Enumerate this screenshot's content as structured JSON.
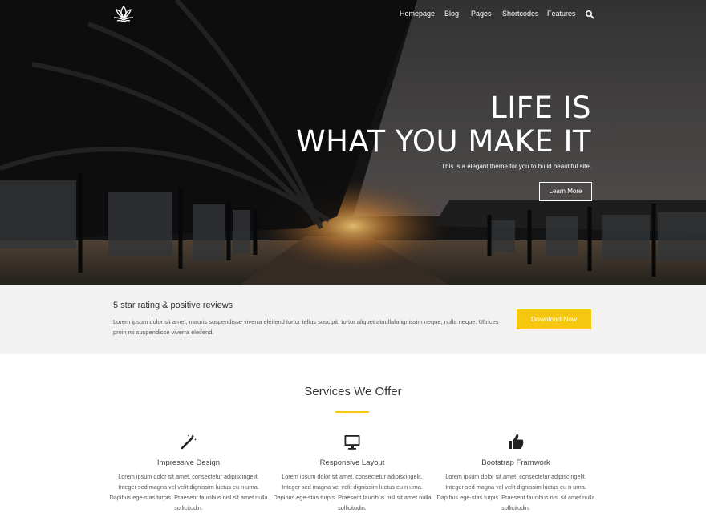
{
  "nav": {
    "items": [
      "Homepage",
      "Blog",
      "Pages",
      "Shortcodes",
      "Features"
    ]
  },
  "hero": {
    "title_line1": "LIFE IS",
    "title_line2": "WHAT YOU MAKE IT",
    "subtitle": "This is a elegant theme for you to build beautiful site.",
    "button_label": "Learn More"
  },
  "cta": {
    "heading": "5 star rating & positive reviews",
    "text": "Lorem ipsum dolor sit amet, mauris suspendisse viverra eleifend tortor tellus suscipit, tortor aliquet atnullafa ignissim neque, nulla neque. Ultrices proin mi suspendisse viverra eleifend.",
    "button_label": "Download Now"
  },
  "services": {
    "title": "Services We Offer",
    "items": [
      {
        "icon": "magic-wand-icon",
        "title": "Impressive Design",
        "text": "Lorem ipsum dolor sit amet, consectetur adipiscingelit. Integer sed magna vel velit dignissim luctus eu n urna. Dapibus ege-stas turpis. Praesent faucibus nisl sit amet nulla sollicitudin."
      },
      {
        "icon": "monitor-icon",
        "title": "Responsive Layout",
        "text": "Lorem ipsum dolor sit amet, consectetur adipiscingelit. Integer sed magna vel velit dignissim luctus eu n urna. Dapibus ege-stas turpis. Praesent faucibus nisl sit amet nulla sollicitudin."
      },
      {
        "icon": "thumbs-up-icon",
        "title": "Bootstrap Framwork",
        "text": "Lorem ipsum dolor sit amet, consectetur adipiscingelit. Integer sed magna vel velit dignissim luctus eu n urna. Dapibus ege-stas turpis. Praesent faucibus nisl sit amet nulla sollicitudin."
      }
    ]
  },
  "colors": {
    "accent": "#f5c70e",
    "band": "#f2f2f2"
  }
}
